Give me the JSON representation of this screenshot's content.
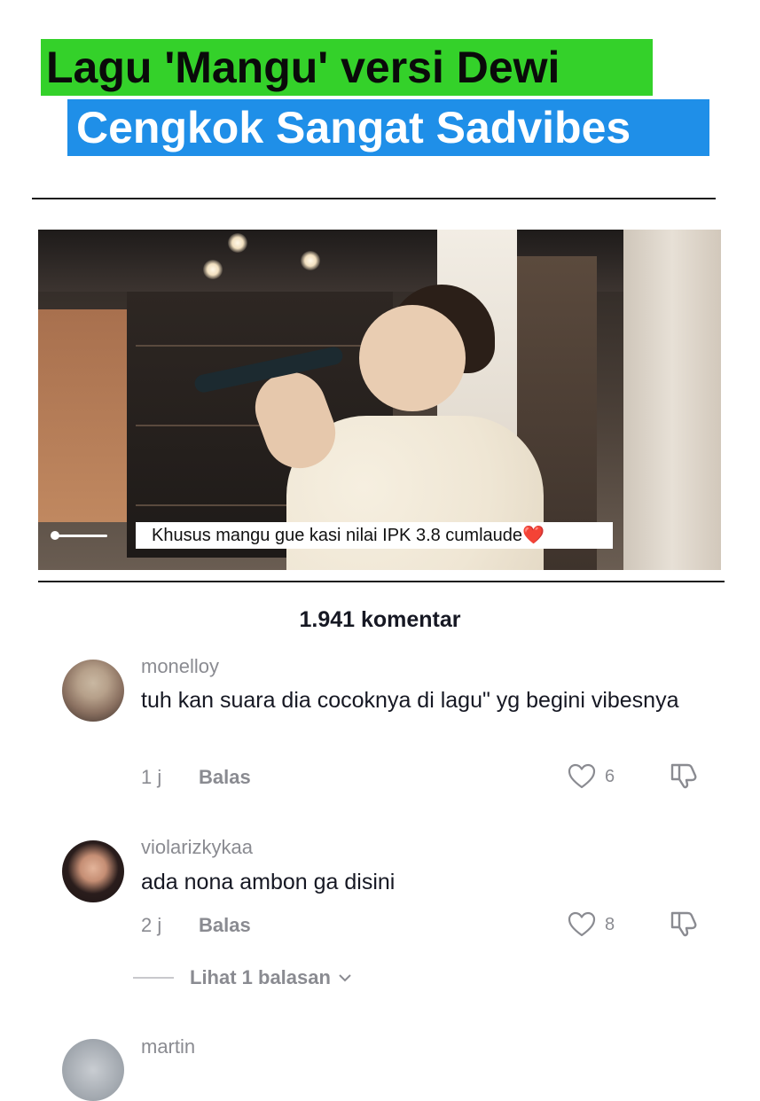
{
  "headline": {
    "line1": "Lagu 'Mangu' versi Dewi",
    "line2": "Cengkok Sangat Sadvibes",
    "line1_bg": "#34d12a",
    "line2_bg": "#1f8fe8"
  },
  "video": {
    "caption": "Khusus mangu gue kasi nilai IPK 3.8 cumlaude❤️"
  },
  "comments_count": "1.941 komentar",
  "comments": [
    {
      "username": "monelloy",
      "text": "tuh kan suara dia cocoknya di lagu\" yg begini vibesnya",
      "time": "1 j",
      "reply_label": "Balas",
      "likes": "6"
    },
    {
      "username": "violarizkykaa",
      "text": "ada nona ambon ga disini",
      "time": "2 j",
      "reply_label": "Balas",
      "likes": "8",
      "view_replies": "Lihat 1 balasan"
    },
    {
      "username": "martin"
    }
  ],
  "icons": {
    "like": "heart-outline-icon",
    "dislike": "thumbs-down-icon",
    "chevron": "chevron-down-icon"
  }
}
